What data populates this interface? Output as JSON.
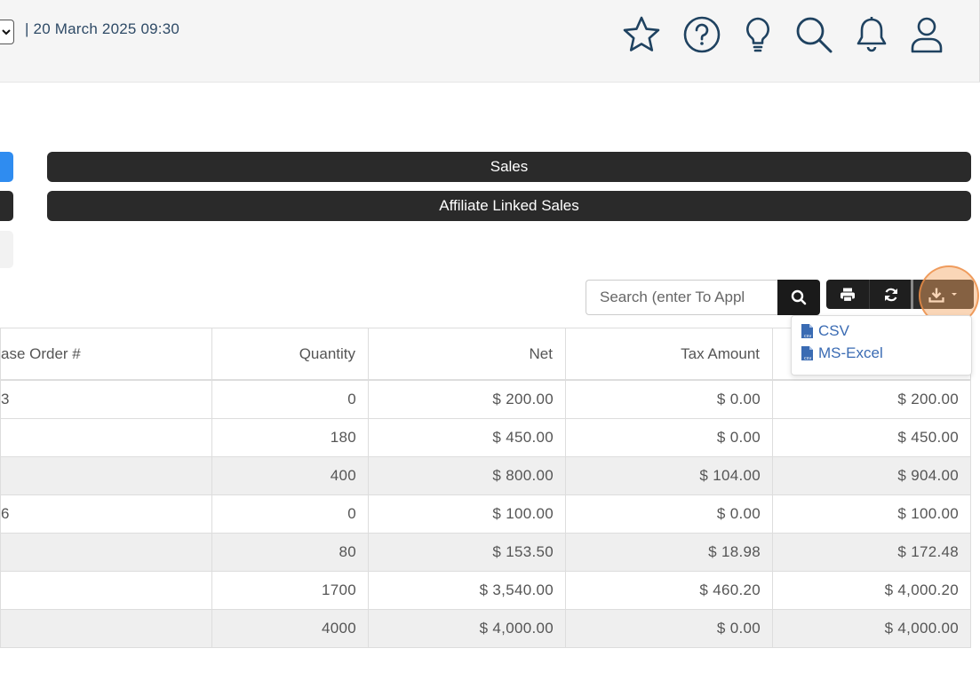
{
  "header": {
    "datetime": "| 20 March 2025 09:30",
    "icons": [
      "star-icon",
      "help-icon",
      "lightbulb-icon",
      "search-icon",
      "bell-icon",
      "user-icon"
    ]
  },
  "tabs": {
    "sales": "Sales",
    "affiliate": "Affiliate Linked Sales"
  },
  "search": {
    "placeholder": "Search (enter To Appl"
  },
  "export_menu": {
    "items": [
      "CSV",
      "MS-Excel"
    ]
  },
  "table": {
    "headers": [
      "ase Order #",
      "Quantity",
      "Net",
      "Tax Amount",
      ""
    ],
    "rows": [
      [
        "3",
        "0",
        "$ 200.00",
        "$ 0.00",
        "$ 200.00"
      ],
      [
        "",
        "180",
        "$ 450.00",
        "$ 0.00",
        "$ 450.00"
      ],
      [
        "",
        "400",
        "$ 800.00",
        "$ 104.00",
        "$ 904.00"
      ],
      [
        "6",
        "0",
        "$ 100.00",
        "$ 0.00",
        "$ 100.00"
      ],
      [
        "",
        "80",
        "$ 153.50",
        "$ 18.98",
        "$ 172.48"
      ],
      [
        "",
        "1700",
        "$ 3,540.00",
        "$ 460.20",
        "$ 4,000.20"
      ],
      [
        "",
        "4000",
        "$ 4,000.00",
        "$ 0.00",
        "$ 4,000.00"
      ]
    ]
  },
  "colors": {
    "accent_blue": "#2f8cf0",
    "dark_bar": "#2a2a2a",
    "highlight": "#f4a460"
  }
}
